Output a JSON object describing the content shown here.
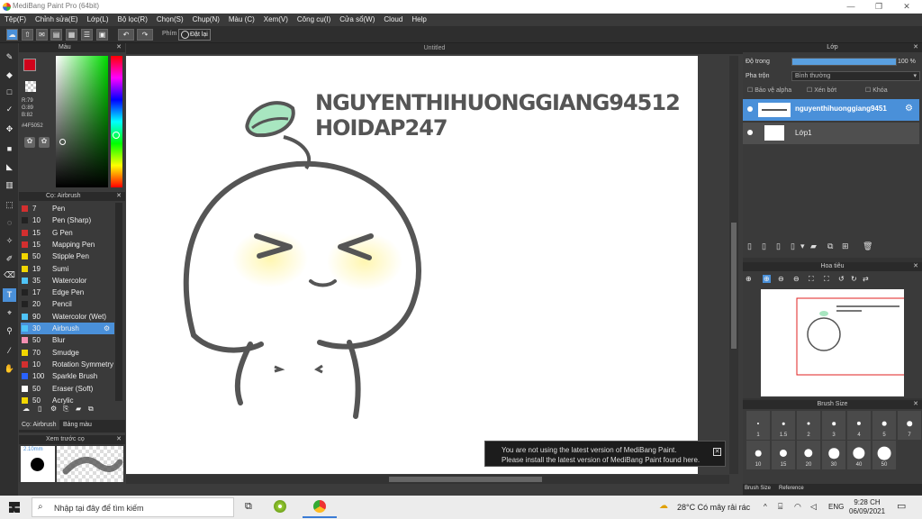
{
  "window": {
    "title": "MediBang Paint Pro (64bit)"
  },
  "menu": [
    "Tệp(F)",
    "Chỉnh sửa(E)",
    "Lớp(L)",
    "Bộ lọc(R)",
    "Chọn(S)",
    "Chụp(N)",
    "Màu (C)",
    "Xem(V)",
    "Công cụ(I)",
    "Cửa sổ(W)",
    "Cloud",
    "Help"
  ],
  "toolbar": {
    "snap_label": "Phím",
    "snap_value": "Đặt lại"
  },
  "color_panel": {
    "title": "Màu",
    "rgb": [
      "R:79",
      "G:89",
      "B:82"
    ],
    "hex": "#4F5052",
    "fg": "#d0021b"
  },
  "brush_panel": {
    "title": "Cọ: Airbrush",
    "brushes": [
      {
        "size": "7",
        "name": "Pen",
        "color": "#d32f2f"
      },
      {
        "size": "10",
        "name": "Pen (Sharp)",
        "color": "#222222"
      },
      {
        "size": "15",
        "name": "G Pen",
        "color": "#d32f2f"
      },
      {
        "size": "15",
        "name": "Mapping Pen",
        "color": "#d32f2f"
      },
      {
        "size": "50",
        "name": "Stipple Pen",
        "color": "#f2d600"
      },
      {
        "size": "19",
        "name": "Sumi",
        "color": "#f2d600"
      },
      {
        "size": "35",
        "name": "Watercolor",
        "color": "#4fc3f7"
      },
      {
        "size": "17",
        "name": "Edge Pen",
        "color": "#222222"
      },
      {
        "size": "20",
        "name": "Pencil",
        "color": "#222222"
      },
      {
        "size": "90",
        "name": "Watercolor (Wet)",
        "color": "#4fc3f7"
      },
      {
        "size": "30",
        "name": "Airbrush",
        "color": "#4fc3f7",
        "selected": true
      },
      {
        "size": "50",
        "name": "Blur",
        "color": "#f48fb1"
      },
      {
        "size": "70",
        "name": "Smudge",
        "color": "#f2d600"
      },
      {
        "size": "10",
        "name": "Rotation Symmetry",
        "color": "#d32f2f"
      },
      {
        "size": "100",
        "name": "Sparkle Brush",
        "color": "#2962ff"
      },
      {
        "size": "50",
        "name": "Eraser (Soft)",
        "color": "#ffffff"
      },
      {
        "size": "50",
        "name": "Acrylic",
        "color": "#f2d600"
      }
    ],
    "tabs": [
      "Cọ: Airbrush",
      "Bảng màu"
    ]
  },
  "preview_panel": {
    "title": "Xem trước cọ",
    "size": "2.10mm"
  },
  "canvas": {
    "tab": "Untitled",
    "text_line1": "NGUYENTHIHUONGGIANG94512",
    "text_line2": "HOIDAP247"
  },
  "notice": {
    "line1": "You are not using the latest version of MediBang Paint.",
    "line2": "Please install the latest version of MediBang Paint found here."
  },
  "layer_panel": {
    "title": "Lớp",
    "opacity_label": "Độ trong",
    "opacity_value": "100 %",
    "opacity_fraction": 1.0,
    "blend_label": "Pha trộn",
    "blend_value": "Bình thường",
    "options": [
      "Bảo vệ alpha",
      "Xén bớt",
      "Khóa"
    ],
    "layers": [
      {
        "name": "nguyenthihuonggiang9451",
        "selected": true
      },
      {
        "name": "Lớp1",
        "selected": false
      }
    ]
  },
  "navigator": {
    "title": "Hoa tiêu"
  },
  "brush_size_panel": {
    "title": "Brush Size",
    "row1": [
      "1",
      "1.5",
      "2",
      "3",
      "4",
      "5",
      "7"
    ],
    "row2": [
      "10",
      "15",
      "20",
      "30",
      "40",
      "50"
    ],
    "tabs": [
      "Brush Size",
      "Reference"
    ]
  },
  "taskbar": {
    "search_placeholder": "Nhập tại đây để tìm kiếm",
    "weather": "28°C  Có mây rải rác",
    "lang": "ENG",
    "time": "9:28 CH",
    "date": "06/09/2021"
  }
}
